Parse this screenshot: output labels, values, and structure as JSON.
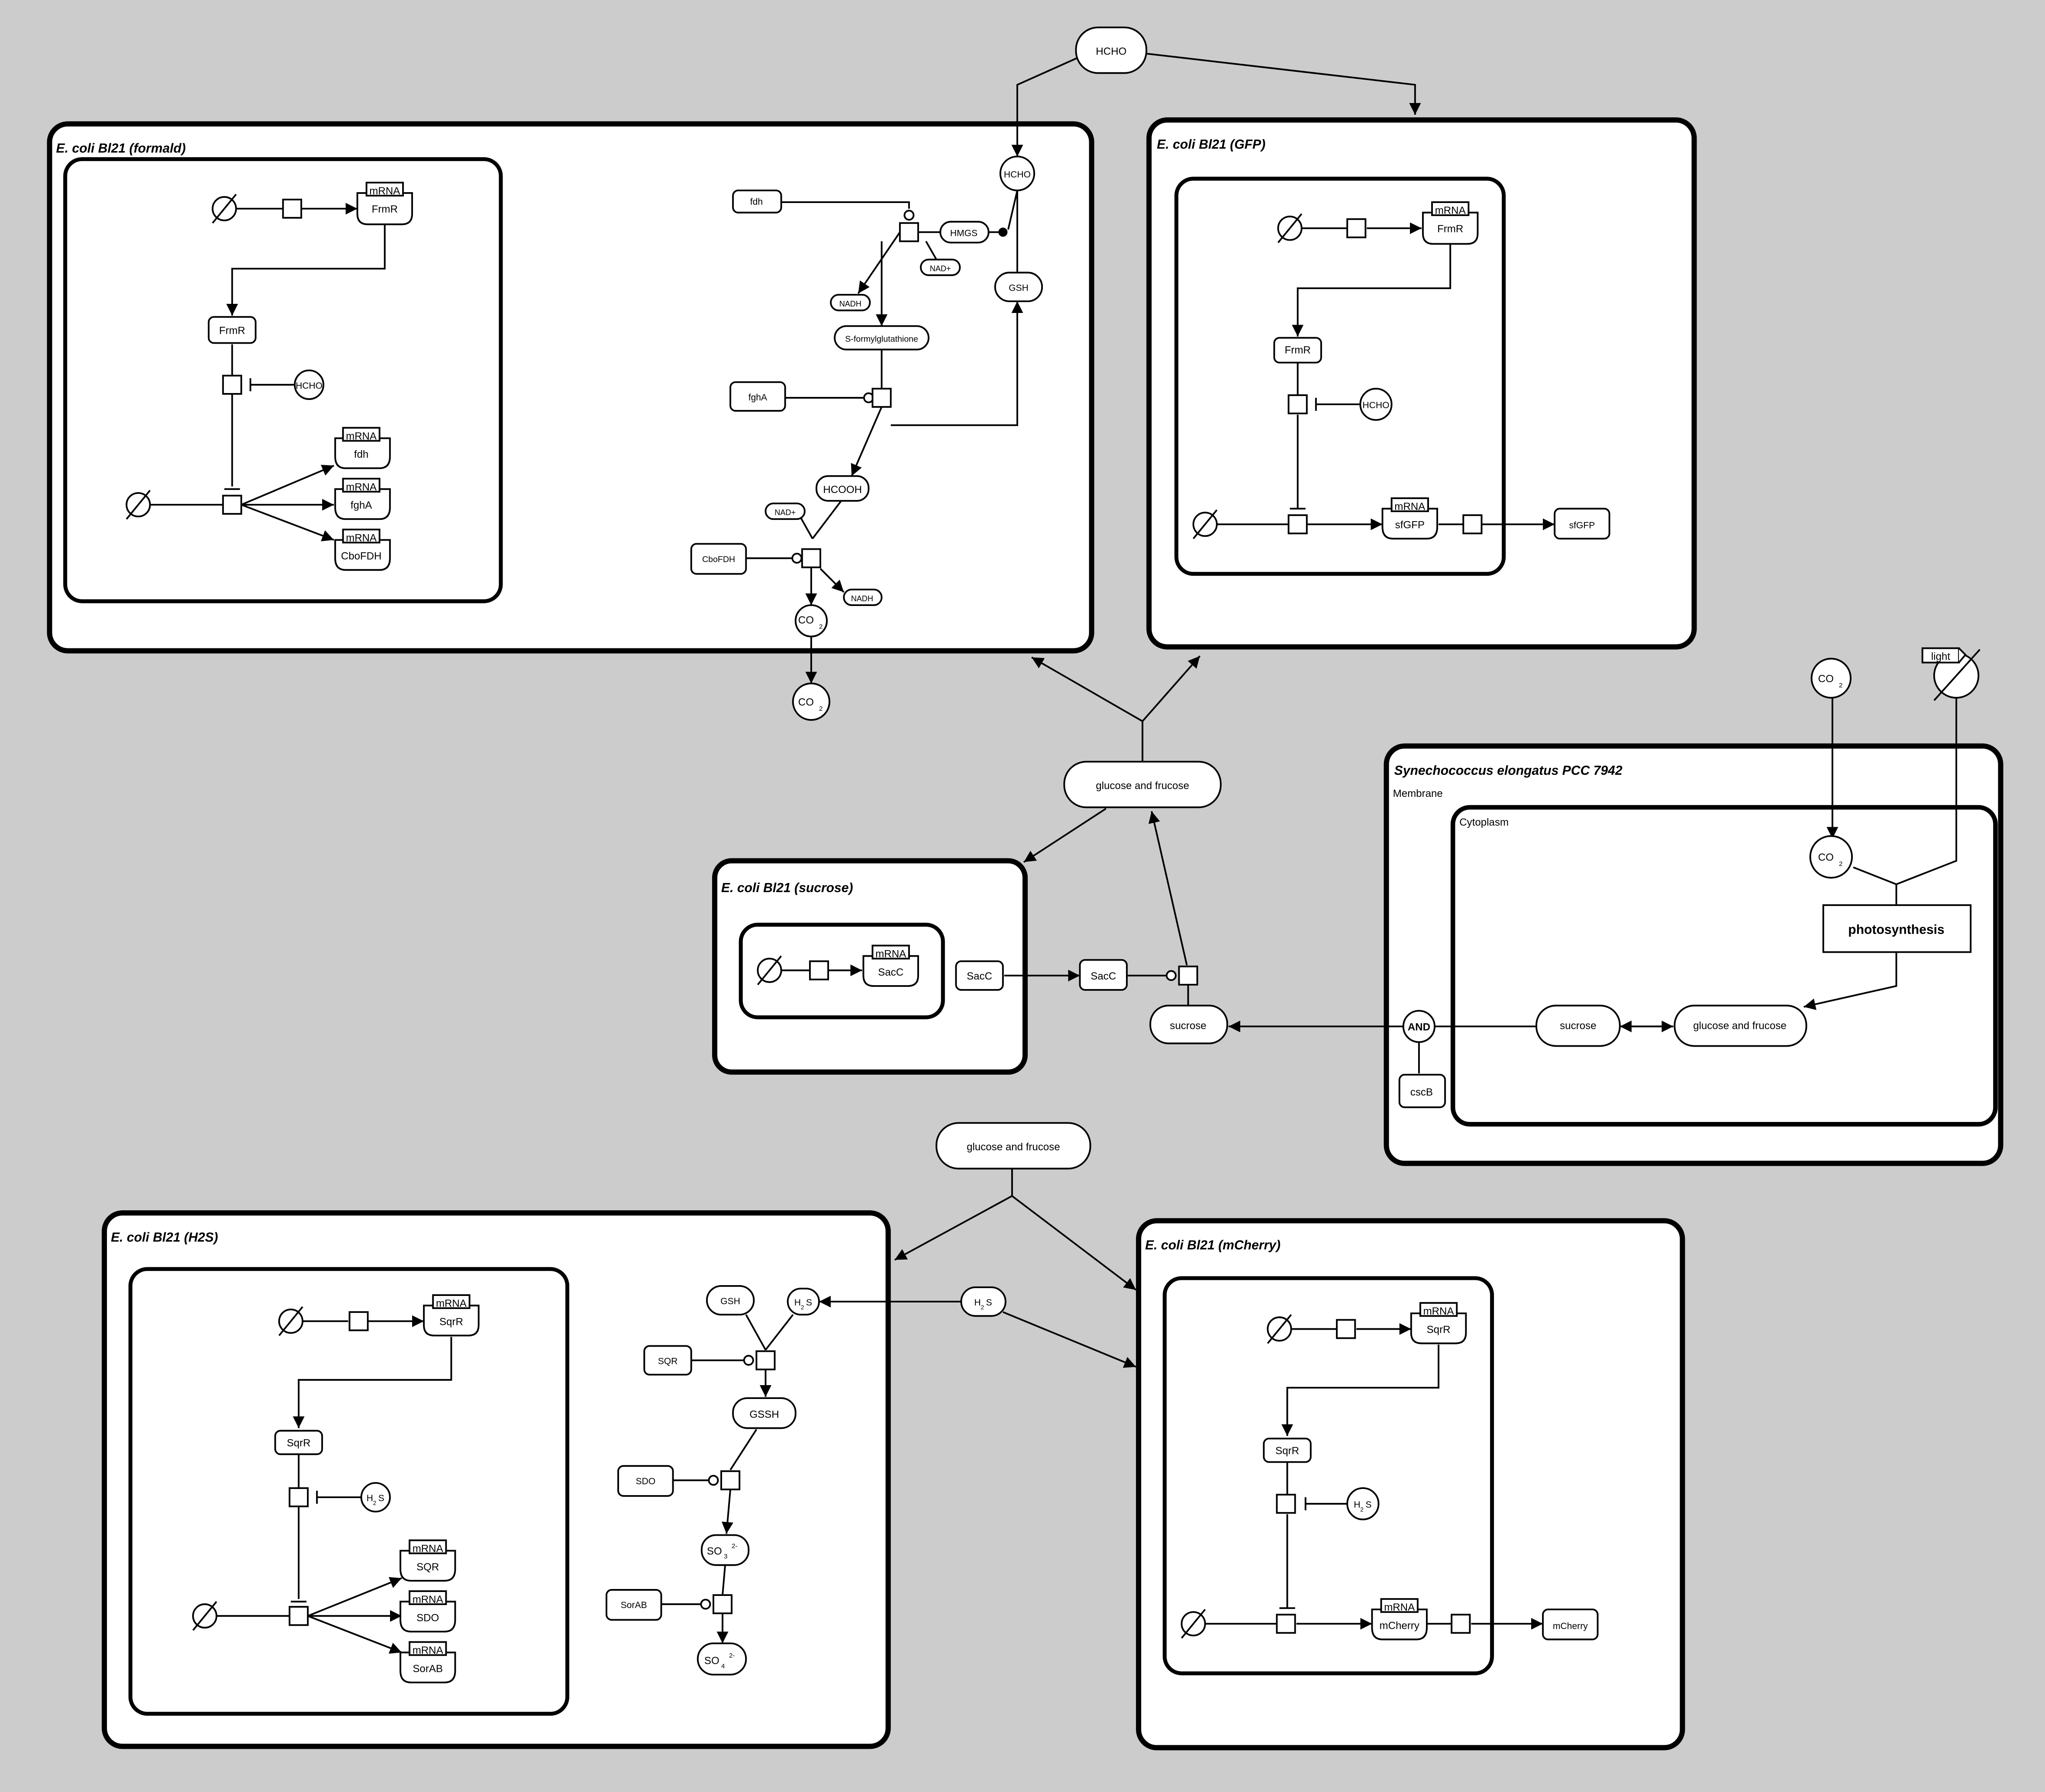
{
  "compartments": {
    "formald": "E. coli Bl21 (formald)",
    "gfp": "E. coli Bl21 (GFP)",
    "sucrose": "E. coli Bl21 (sucrose)",
    "synechococcus": "Synechococcus elongatus PCC 7942",
    "membrane": "Membrane",
    "cytoplasm": "Cytoplasm",
    "h2s": "E. coli Bl21 (H2S)",
    "mcherry": "E. coli Bl21 (mCherry)"
  },
  "labels": {
    "mrna": "mRNA",
    "frmr": "FrmR",
    "fdh": "fdh",
    "fgha": "fghA",
    "cbofdh": "CboFDH",
    "hcho": "HCHO",
    "hmgs": "HMGS",
    "nadplus": "NAD+",
    "nadh": "NADH",
    "gsh": "GSH",
    "sformyl": "S-formylglutathione",
    "hcooh": "HCOOH",
    "co": "CO",
    "sub2": "2",
    "sfgfp": "sfGFP",
    "sacc": "SacC",
    "sucrose": "sucrose",
    "glucfruc": "glucose and frucose",
    "and": "AND",
    "cscb": "cscB",
    "photosynthesis": "photosynthesis",
    "light": "light",
    "sqrr": "SqrR",
    "sqr": "SQR",
    "sdo": "SDO",
    "sorab": "SorAB",
    "h": "H",
    "s": "S",
    "gssh": "GSSH",
    "so": "SO",
    "sub3": "3",
    "sub4": "4",
    "charge": "2-",
    "mcherry": "mCherry"
  }
}
